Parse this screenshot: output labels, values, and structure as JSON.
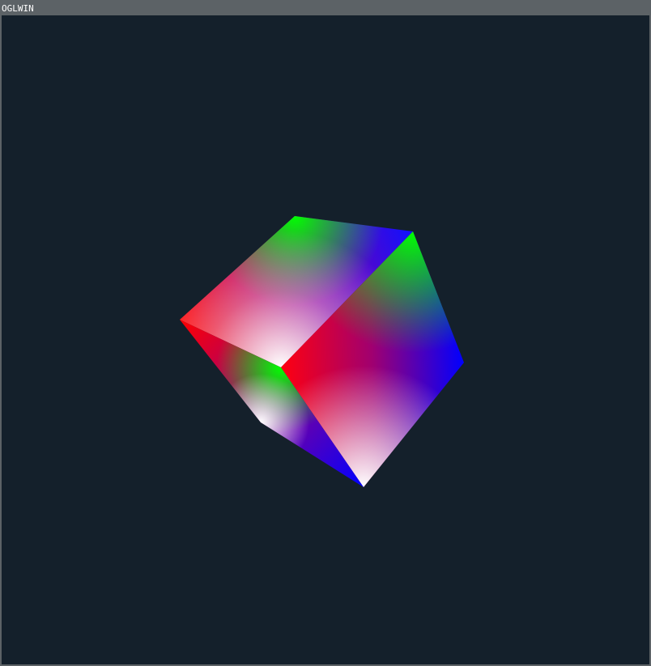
{
  "window": {
    "title": "OGLWIN",
    "background_color": "#14202b",
    "titlebar_color": "#5c6266",
    "title_text_color": "#ffffff"
  },
  "scene": {
    "object": "rgb-gradient-cube",
    "vertex_colors": [
      "#ff0000",
      "#00ff00",
      "#0000ff",
      "#ffffff"
    ]
  }
}
